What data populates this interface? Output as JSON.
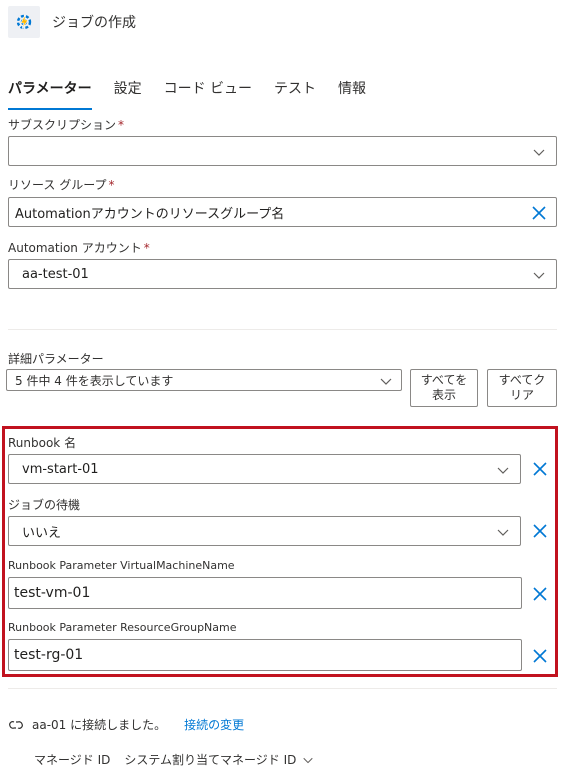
{
  "header": {
    "title": "ジョブの作成",
    "icon": "runbook-gear-icon"
  },
  "tabs": [
    {
      "label": "パラメーター",
      "active": true
    },
    {
      "label": "設定",
      "active": false
    },
    {
      "label": "コード ビュー",
      "active": false
    },
    {
      "label": "テスト",
      "active": false
    },
    {
      "label": "情報",
      "active": false
    }
  ],
  "fields": {
    "subscription": {
      "label": "サブスクリプション",
      "required_mark": "*",
      "value": ""
    },
    "resource_group": {
      "label": "リソース グループ",
      "required_mark": "*",
      "value": "Automationアカウントのリソースグループ名"
    },
    "automation_account": {
      "label": "Automation アカウント",
      "required_mark": "*",
      "value": "aa-test-01"
    }
  },
  "advanced": {
    "label": "詳細パラメーター",
    "summary": "5 件中 4 件を表示しています",
    "show_all_label": "すべてを表示",
    "show_all_line1": "すべてを",
    "show_all_line2": "表示",
    "clear_all_line1": "すべてク",
    "clear_all_line2": "リア"
  },
  "runbook_params": [
    {
      "label": "Runbook 名",
      "value": "vm-start-01",
      "kind": "select"
    },
    {
      "label": "ジョブの待機",
      "value": "いいえ",
      "kind": "select"
    },
    {
      "label": "Runbook Parameter VirtualMachineName",
      "value": "test-vm-01",
      "kind": "input"
    },
    {
      "label": "Runbook Parameter ResourceGroupName",
      "value": "test-rg-01",
      "kind": "input"
    }
  ],
  "connection": {
    "status": "aa-01 に接続しました。",
    "change_link": "接続の変更",
    "managed_id_label": "マネージド ID",
    "managed_id_value": "システム割り当てマネージド ID"
  },
  "colors": {
    "accent": "#0078d4",
    "highlight_border": "#c1121f",
    "required": "#a4262c"
  }
}
